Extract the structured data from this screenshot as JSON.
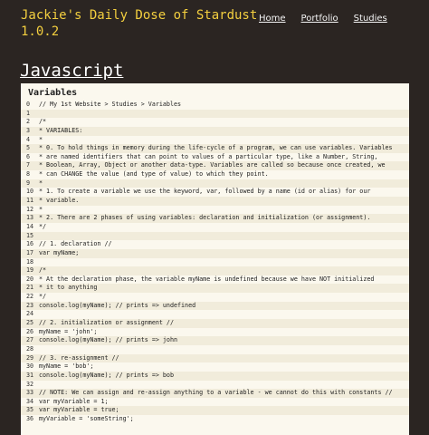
{
  "header": {
    "site_title": "Jackie's Daily Dose of Stardust\n1.0.2",
    "nav": [
      "Home",
      "Portfolio",
      "Studies"
    ]
  },
  "section_title": "Javascript",
  "panel": {
    "title": "Variables",
    "lines": [
      {
        "n": "0",
        "text": "// My 1st Website > Studies > Variables"
      },
      {
        "n": "1",
        "text": ""
      },
      {
        "n": "2",
        "text": "/*"
      },
      {
        "n": "3",
        "text": "* VARIABLES:"
      },
      {
        "n": "4",
        "text": "*"
      },
      {
        "n": "5",
        "text": "* 0. To hold things in memory during the life-cycle of a program, we can use variables. Variables"
      },
      {
        "n": "6",
        "text": "* are named identifiers that can point to values of a particular type, like a Number, String,"
      },
      {
        "n": "7",
        "text": "* Boolean, Array, Object or another data-type. Variables are called so because once created, we"
      },
      {
        "n": "8",
        "text": "* can CHANGE the value (and type of value) to which they point."
      },
      {
        "n": "9",
        "text": "*"
      },
      {
        "n": "10",
        "text": "* 1. To create a variable we use the keyword, var, followed by a name (id or alias) for our"
      },
      {
        "n": "11",
        "text": "* variable."
      },
      {
        "n": "12",
        "text": "*"
      },
      {
        "n": "13",
        "text": "* 2. There are 2 phases of using variables: declaration and initialization (or assignment)."
      },
      {
        "n": "14",
        "text": "*/"
      },
      {
        "n": "15",
        "text": ""
      },
      {
        "n": "16",
        "text": "// 1. declaration //"
      },
      {
        "n": "17",
        "text": "var myName;"
      },
      {
        "n": "18",
        "text": ""
      },
      {
        "n": "19",
        "text": "/*"
      },
      {
        "n": "20",
        "text": "* At the declaration phase, the variable myName is undefined because we have NOT initialized"
      },
      {
        "n": "21",
        "text": "* it to anything"
      },
      {
        "n": "22",
        "text": "*/"
      },
      {
        "n": "23",
        "text": "console.log(myName); // prints => undefined"
      },
      {
        "n": "24",
        "text": ""
      },
      {
        "n": "25",
        "text": "// 2. initialization or assignment //"
      },
      {
        "n": "26",
        "text": "myName = 'john';"
      },
      {
        "n": "27",
        "text": "console.log(myName); // prints => john"
      },
      {
        "n": "28",
        "text": ""
      },
      {
        "n": "29",
        "text": "// 3. re-assignment //"
      },
      {
        "n": "30",
        "text": "myName = 'bob';"
      },
      {
        "n": "31",
        "text": "console.log(myName); // prints => bob"
      },
      {
        "n": "32",
        "text": ""
      },
      {
        "n": "33",
        "text": "// NOTE: We can assign and re-assign anything to a variable - we cannot do this with constants //"
      },
      {
        "n": "34",
        "text": "var myVariable = 1;"
      },
      {
        "n": "35",
        "text": "var myVariable = true;"
      },
      {
        "n": "36",
        "text": "myVariable = 'someString';"
      }
    ]
  }
}
